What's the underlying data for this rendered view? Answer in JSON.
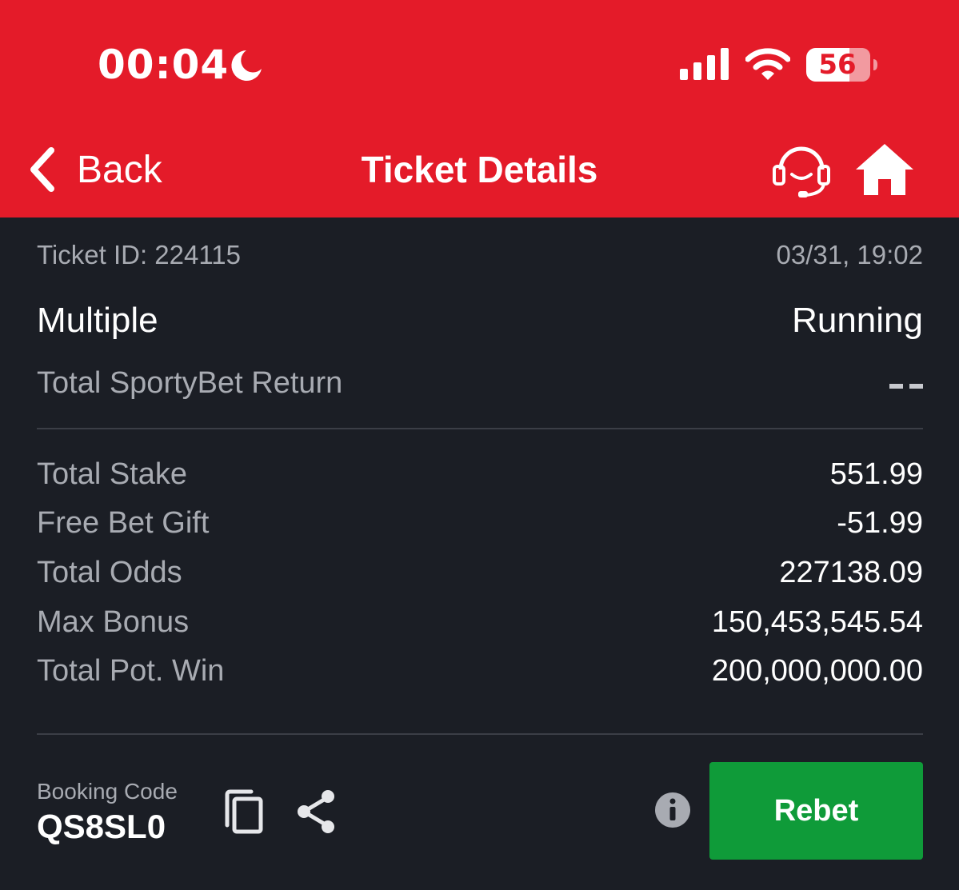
{
  "status_bar": {
    "time": "00:04",
    "battery": "56",
    "icons": [
      "moon-icon",
      "signal-icon",
      "wifi-icon",
      "battery-icon"
    ]
  },
  "nav": {
    "back_label": "Back",
    "title": "Ticket Details",
    "icons": [
      "chevron-left-icon",
      "support-headset-icon",
      "home-icon"
    ]
  },
  "ticket": {
    "id_label": "Ticket ID: 224115",
    "datetime": "03/31, 19:02",
    "type": "Multiple",
    "status": "Running",
    "return_label": "Total SportyBet Return",
    "return_value": "--"
  },
  "summary": [
    {
      "label": "Total Stake",
      "value": "551.99"
    },
    {
      "label": "Free Bet Gift",
      "value": "-51.99"
    },
    {
      "label": "Total Odds",
      "value": "227138.09"
    },
    {
      "label": "Max Bonus",
      "value": "150,453,545.54"
    },
    {
      "label": "Total Pot. Win",
      "value": "200,000,000.00"
    }
  ],
  "booking": {
    "label": "Booking Code",
    "code": "QS8SL0",
    "icons": [
      "copy-icon",
      "share-icon",
      "info-icon"
    ]
  },
  "actions": {
    "rebet_label": "Rebet"
  },
  "colors": {
    "brand_red": "#e41b29",
    "background": "#1b1e25",
    "rebet_green": "#0f9b39",
    "muted_text": "#a8abb2"
  }
}
